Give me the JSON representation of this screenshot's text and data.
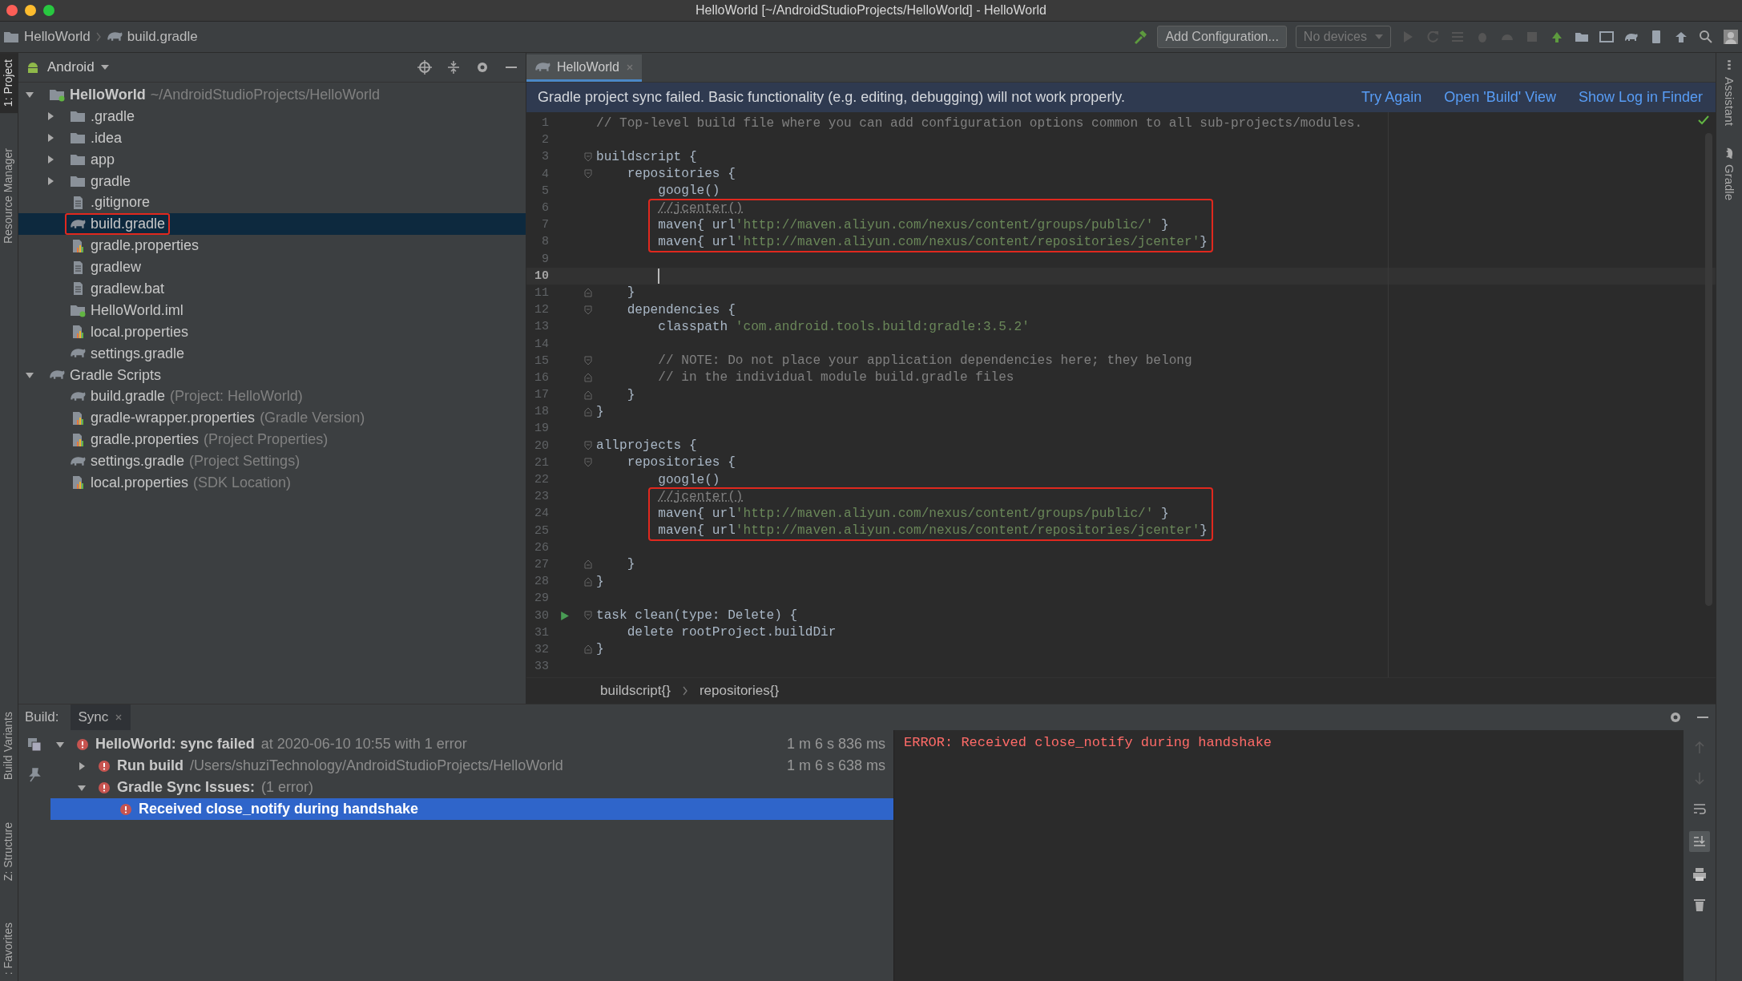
{
  "window": {
    "title": "HelloWorld [~/AndroidStudioProjects/HelloWorld] - HelloWorld"
  },
  "navbar": {
    "breadcrumbs": [
      {
        "label": "HelloWorld",
        "kind": "module"
      },
      {
        "label": "build.gradle",
        "kind": "gradle"
      }
    ],
    "run_configuration": "Add Configuration...",
    "device": "No devices"
  },
  "left_strip": {
    "top": [
      {
        "label": "1: Project",
        "selected": true
      },
      {
        "label": "Resource Manager",
        "selected": false
      }
    ],
    "bottom": [
      {
        "label": "Build Variants",
        "selected": false
      },
      {
        "label": "Z: Structure",
        "selected": false
      },
      {
        "label": ": Favorites",
        "selected": false
      }
    ]
  },
  "right_strip": [
    {
      "label": "Assistant",
      "kind": "assistant"
    },
    {
      "label": "Gradle",
      "kind": "gradle"
    }
  ],
  "project": {
    "view": "Android",
    "tree": [
      {
        "label": "HelloWorld",
        "hint": "~/AndroidStudioProjects/HelloWorld",
        "kind": "module",
        "bold": true,
        "expanded": true,
        "selected": false,
        "children": [
          {
            "label": ".gradle",
            "kind": "folder",
            "expanded": false,
            "selected": false
          },
          {
            "label": ".idea",
            "kind": "folder",
            "expanded": false,
            "selected": false
          },
          {
            "label": "app",
            "kind": "folder",
            "expanded": false,
            "selected": false
          },
          {
            "label": "gradle",
            "kind": "folder",
            "expanded": false,
            "selected": false
          },
          {
            "label": ".gitignore",
            "kind": "file",
            "selected": false
          },
          {
            "label": "build.gradle",
            "kind": "gradle",
            "selected": true,
            "boxed": true
          },
          {
            "label": "gradle.properties",
            "kind": "properties",
            "selected": false
          },
          {
            "label": "gradlew",
            "kind": "file",
            "selected": false
          },
          {
            "label": "gradlew.bat",
            "kind": "file",
            "selected": false
          },
          {
            "label": "HelloWorld.iml",
            "kind": "module",
            "selected": false
          },
          {
            "label": "local.properties",
            "kind": "properties",
            "selected": false
          },
          {
            "label": "settings.gradle",
            "kind": "gradle",
            "selected": false
          }
        ]
      },
      {
        "label": "Gradle Scripts",
        "kind": "gradle",
        "expanded": true,
        "selected": false,
        "children": [
          {
            "label": "build.gradle",
            "hint": "(Project: HelloWorld)",
            "kind": "gradle",
            "selected": false
          },
          {
            "label": "gradle-wrapper.properties",
            "hint": "(Gradle Version)",
            "kind": "properties",
            "selected": false
          },
          {
            "label": "gradle.properties",
            "hint": "(Project Properties)",
            "kind": "properties",
            "selected": false
          },
          {
            "label": "settings.gradle",
            "hint": "(Project Settings)",
            "kind": "gradle",
            "selected": false
          },
          {
            "label": "local.properties",
            "hint": "(SDK Location)",
            "kind": "properties",
            "selected": false
          }
        ]
      }
    ]
  },
  "editor": {
    "tabs": [
      {
        "label": "HelloWorld",
        "selected": true
      }
    ],
    "banner": {
      "message": "Gradle project sync failed. Basic functionality (e.g. editing, debugging) will not work properly.",
      "links": [
        "Try Again",
        "Open 'Build' View",
        "Show Log in Finder"
      ]
    },
    "lines": [
      {
        "number": "1",
        "segments": [
          {
            "text": "// Top-level build file where you can add configuration options common to all sub-projects/modules.",
            "kind": "comment"
          }
        ]
      },
      {
        "number": "2"
      },
      {
        "number": "3",
        "fold_start": true,
        "segments": [
          {
            "text": "buildscript {",
            "kind": "plain"
          }
        ]
      },
      {
        "number": "4",
        "fold_start": true,
        "segments": [
          {
            "text": "    repositories {",
            "kind": "plain"
          }
        ]
      },
      {
        "number": "5",
        "segments": [
          {
            "text": "        google()",
            "kind": "plain"
          }
        ]
      },
      {
        "number": "6",
        "boxed": true,
        "segments": [
          {
            "text": "        //jcenter()",
            "kind": "typo-comment"
          }
        ]
      },
      {
        "number": "7",
        "boxed": true,
        "segments": [
          {
            "text": "        maven{ url",
            "kind": "plain"
          },
          {
            "text": "'http://maven.aliyun.com/nexus/content/groups/public/'",
            "kind": "string"
          },
          {
            "text": " }",
            "kind": "plain"
          }
        ]
      },
      {
        "number": "8",
        "boxed": true,
        "segments": [
          {
            "text": "        maven{ url",
            "kind": "plain"
          },
          {
            "text": "'http://maven.aliyun.com/nexus/content/repositories/jcenter'",
            "kind": "string"
          },
          {
            "text": "}",
            "kind": "plain"
          }
        ]
      },
      {
        "number": "9"
      },
      {
        "number": "10",
        "current": true,
        "caret": true
      },
      {
        "number": "11",
        "fold_end": true,
        "segments": [
          {
            "text": "    }",
            "kind": "plain"
          }
        ]
      },
      {
        "number": "12",
        "fold_start": true,
        "segments": [
          {
            "text": "    dependencies {",
            "kind": "plain"
          }
        ]
      },
      {
        "number": "13",
        "segments": [
          {
            "text": "        classpath ",
            "kind": "plain"
          },
          {
            "text": "'com.android.tools.build:gradle:3.5.2'",
            "kind": "string"
          }
        ]
      },
      {
        "number": "14"
      },
      {
        "number": "15",
        "fold_start": true,
        "segments": [
          {
            "text": "        // NOTE: Do not place your application dependencies here; they belong",
            "kind": "comment"
          }
        ]
      },
      {
        "number": "16",
        "fold_end": true,
        "segments": [
          {
            "text": "        // in the individual module build.gradle files",
            "kind": "comment"
          }
        ]
      },
      {
        "number": "17",
        "fold_end": true,
        "segments": [
          {
            "text": "    }",
            "kind": "plain"
          }
        ]
      },
      {
        "number": "18",
        "fold_end": true,
        "segments": [
          {
            "text": "}",
            "kind": "plain"
          }
        ]
      },
      {
        "number": "19"
      },
      {
        "number": "20",
        "fold_start": true,
        "segments": [
          {
            "text": "allprojects {",
            "kind": "plain"
          }
        ]
      },
      {
        "number": "21",
        "fold_start": true,
        "segments": [
          {
            "text": "    repositories {",
            "kind": "plain"
          }
        ]
      },
      {
        "number": "22",
        "segments": [
          {
            "text": "        google()",
            "kind": "plain"
          }
        ]
      },
      {
        "number": "23",
        "boxed": true,
        "segments": [
          {
            "text": "        //jcenter()",
            "kind": "typo-comment"
          }
        ]
      },
      {
        "number": "24",
        "boxed": true,
        "segments": [
          {
            "text": "        maven{ url",
            "kind": "plain"
          },
          {
            "text": "'http://maven.aliyun.com/nexus/content/groups/public/'",
            "kind": "string"
          },
          {
            "text": " }",
            "kind": "plain"
          }
        ]
      },
      {
        "number": "25",
        "boxed": true,
        "segments": [
          {
            "text": "        maven{ url",
            "kind": "plain"
          },
          {
            "text": "'http://maven.aliyun.com/nexus/content/repositories/jcenter'",
            "kind": "string"
          },
          {
            "text": "}",
            "kind": "plain"
          }
        ]
      },
      {
        "number": "26"
      },
      {
        "number": "27",
        "fold_end": true,
        "segments": [
          {
            "text": "    }",
            "kind": "plain"
          }
        ]
      },
      {
        "number": "28",
        "fold_end": true,
        "segments": [
          {
            "text": "}",
            "kind": "plain"
          }
        ]
      },
      {
        "number": "29"
      },
      {
        "number": "30",
        "fold_start": true,
        "run": true,
        "segments": [
          {
            "text": "task clean(type: Delete) {",
            "kind": "plain"
          }
        ]
      },
      {
        "number": "31",
        "segments": [
          {
            "text": "    delete rootProject.buildDir",
            "kind": "plain"
          }
        ]
      },
      {
        "number": "32",
        "fold_end": true,
        "segments": [
          {
            "text": "}",
            "kind": "plain"
          }
        ]
      },
      {
        "number": "33"
      }
    ],
    "breadcrumb": [
      "buildscript{}",
      "repositories{}"
    ]
  },
  "build": {
    "label": "Build:",
    "tabs": [
      {
        "label": "Sync",
        "selected": true
      }
    ],
    "tree": [
      {
        "label": "HelloWorld: sync failed",
        "detail": "at 2020-06-10 10:55  with 1 error",
        "time": "1 m 6 s 836 ms",
        "kind": "error",
        "expanded": true,
        "selected": false,
        "children": [
          {
            "label": "Run build",
            "detail": "/Users/shuziTechnology/AndroidStudioProjects/HelloWorld",
            "time": "1 m 6 s 638 ms",
            "kind": "error",
            "expanded": false,
            "selected": false
          },
          {
            "label": "Gradle Sync Issues:",
            "detail": "(1 error)",
            "kind": "error",
            "expanded": true,
            "selected": false,
            "children": [
              {
                "label": "Received close_notify during handshake",
                "kind": "error",
                "selected": true
              }
            ]
          }
        ]
      }
    ],
    "console": "ERROR: Received close_notify during handshake"
  }
}
